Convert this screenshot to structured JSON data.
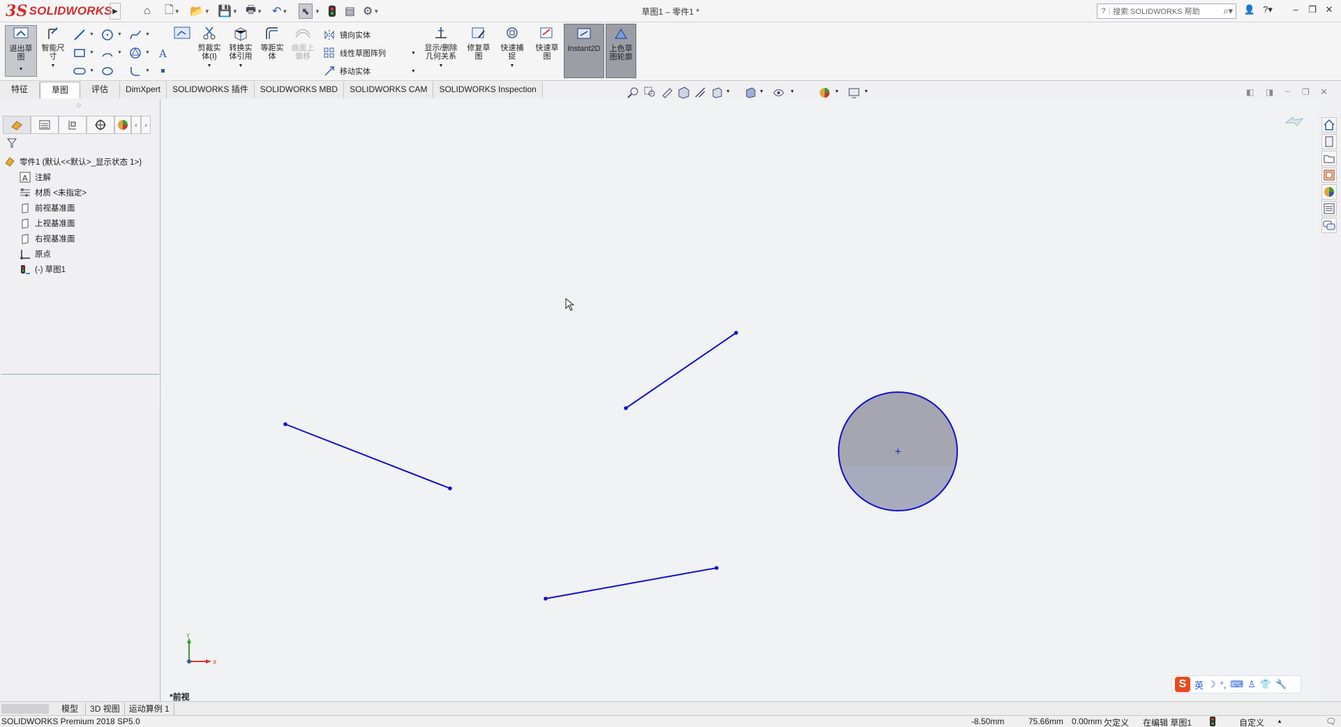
{
  "app": {
    "logo_ds": "3S",
    "logo_text": "SOLIDWORKS",
    "window_title": "草图1 – 零件1 *",
    "help_search_placeholder": "搜索 SOLIDWORKS 帮助"
  },
  "ribbon": {
    "exit_sketch": "退出草图",
    "smart_dimension": "智能尺寸",
    "trim_entities": "剪裁实体(I)",
    "convert_entities": "转换实体引用",
    "offset_entities": "等距实体",
    "offset_on_surface": "曲面上偏移",
    "mirror_entities": "镜向实体",
    "linear_pattern": "线性草图阵列",
    "move_entities": "移动实体",
    "display_relations": "显示/删除几何关系",
    "repair_sketch": "修复草图",
    "quick_snaps": "快速捕捉",
    "rapid_sketch": "快速草图",
    "instant2d": "Instant2D",
    "shaded_contours": "上色草图轮廓"
  },
  "tabs": [
    "特征",
    "草图",
    "评估",
    "DimXpert",
    "SOLIDWORKS 插件",
    "SOLIDWORKS MBD",
    "SOLIDWORKS CAM",
    "SOLIDWORKS Inspection"
  ],
  "tree": {
    "root": "零件1  (默认<<默认>_显示状态 1>)",
    "annotations": "注解",
    "material": "材质 <未指定>",
    "front_plane": "前视基准面",
    "top_plane": "上视基准面",
    "right_plane": "右视基准面",
    "origin": "原点",
    "sketch1": "(-) 草图1"
  },
  "graphics": {
    "view_label": "*前视",
    "triad_x": "X",
    "triad_y": "Y",
    "sketch_color": "#1010d0",
    "circle_fill": "#a8aabe"
  },
  "ime": {
    "logo": "S",
    "mode": "英"
  },
  "bottom_tabs": [
    "模型",
    "3D 视图",
    "运动算例 1"
  ],
  "status": {
    "product": "SOLIDWORKS Premium 2018 SP5.0",
    "x": "-8.50mm",
    "y": "75.66mm",
    "z": "0.00mm",
    "defined": "欠定义",
    "editing": "在编辑 草图1",
    "units": "自定义"
  }
}
